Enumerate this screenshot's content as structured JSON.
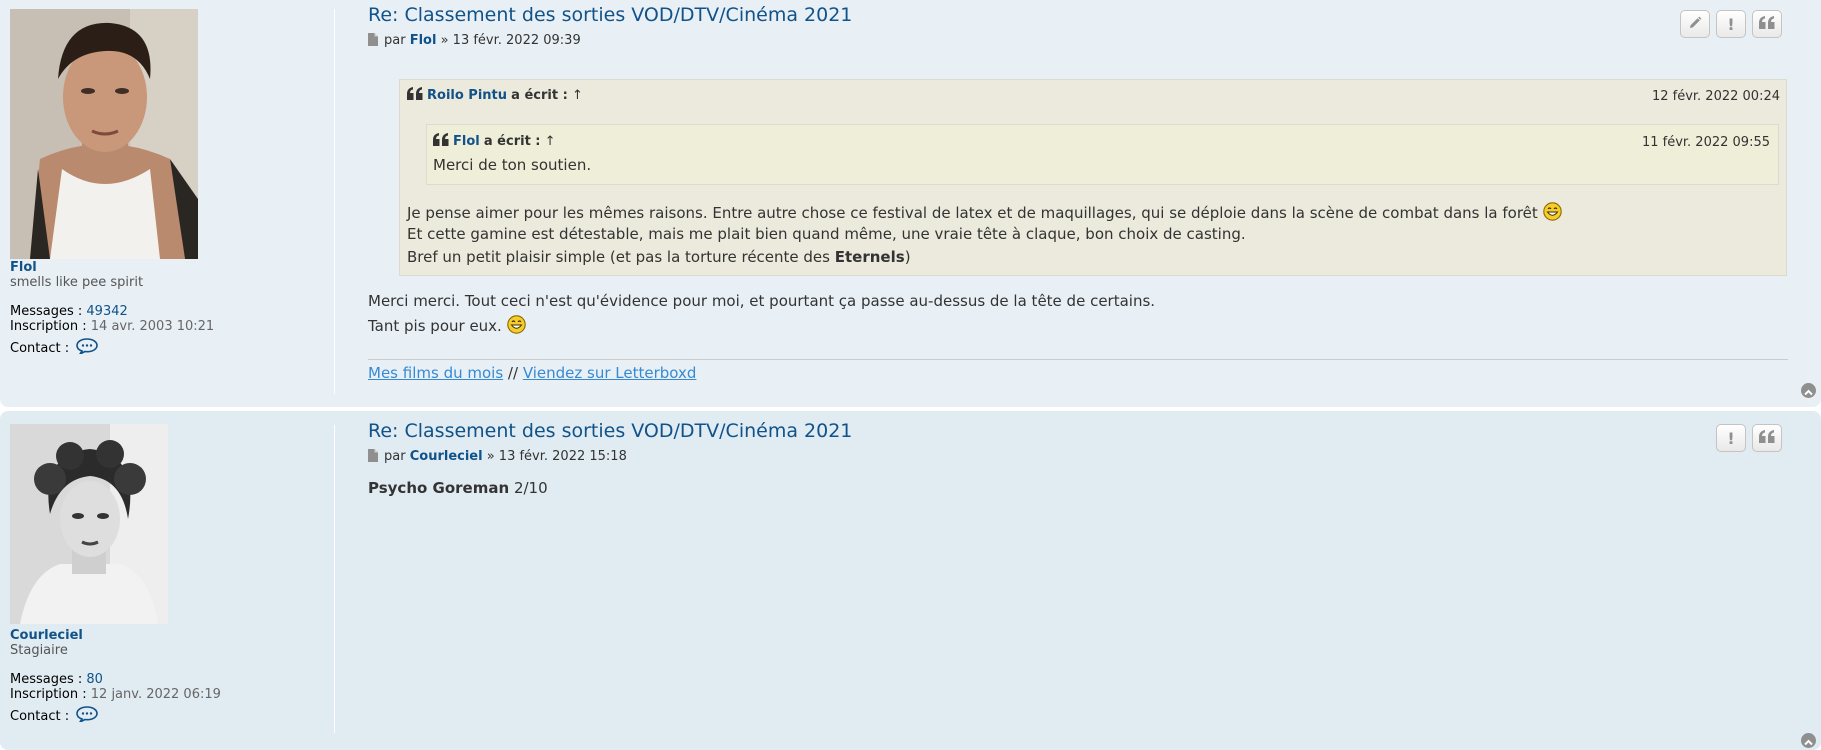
{
  "posts": [
    {
      "author": "Flol",
      "rank": "smells like pee spirit",
      "messages_label": "Messages :",
      "messages": "49342",
      "joined_label": "Inscription :",
      "joined": "14 avr. 2003 10:21",
      "contact_label": "Contact :",
      "title": "Re: Classement des sorties VOD/DTV/Cinéma 2021",
      "meta_by": "par",
      "meta_author": "Flol",
      "meta_date": "» 13 févr. 2022 09:39",
      "quote": {
        "author": "Roilo Pintu",
        "wrote": "a écrit :",
        "arrow": "↑",
        "date": "12 févr. 2022 00:24",
        "nested": {
          "author": "Flol",
          "wrote": "a écrit :",
          "arrow": "↑",
          "date": "11 févr. 2022 09:55",
          "text": "Merci de ton soutien."
        },
        "lines": [
          "Je pense aimer pour les mêmes raisons. Entre autre chose ce festival de latex et de maquillages, qui se déploie dans la scène de combat dans la forêt",
          "Et cette gamine est détestable, mais me plait bien quand même, une vraie tête à claque, bon choix de casting.",
          "Bref un petit plaisir simple (et pas la torture récente des"
        ],
        "bold_word": "Eternels",
        "close_paren": ")"
      },
      "body_lines": [
        "Merci merci. Tout ceci n'est qu'évidence pour moi, et pourtant ça passe au-dessus de la tête de certains.",
        "Tant pis pour eux."
      ],
      "signature": {
        "link1": "Mes films du mois",
        "separator": "//",
        "link2": "Viendez sur Letterboxd"
      }
    },
    {
      "author": "Courleciel",
      "rank": "Stagiaire",
      "messages_label": "Messages :",
      "messages": "80",
      "joined_label": "Inscription :",
      "joined": "12 janv. 2022 06:19",
      "contact_label": "Contact :",
      "title": "Re: Classement des sorties VOD/DTV/Cinéma 2021",
      "meta_by": "par",
      "meta_author": "Courleciel",
      "meta_date": "» 13 févr. 2022 15:18",
      "body_bold": "Psycho Goreman",
      "body_rest": "2/10"
    }
  ],
  "buttons": {
    "report": "!",
    "quote": "❝"
  },
  "colors": {
    "link": "#105289",
    "post_bg_1": "#e9f0f5",
    "post_bg_2": "#e1ebf2",
    "quote_bg": "#ebeadd",
    "nested_quote_bg": "#efeed9",
    "signature_link": "#368ad2"
  }
}
